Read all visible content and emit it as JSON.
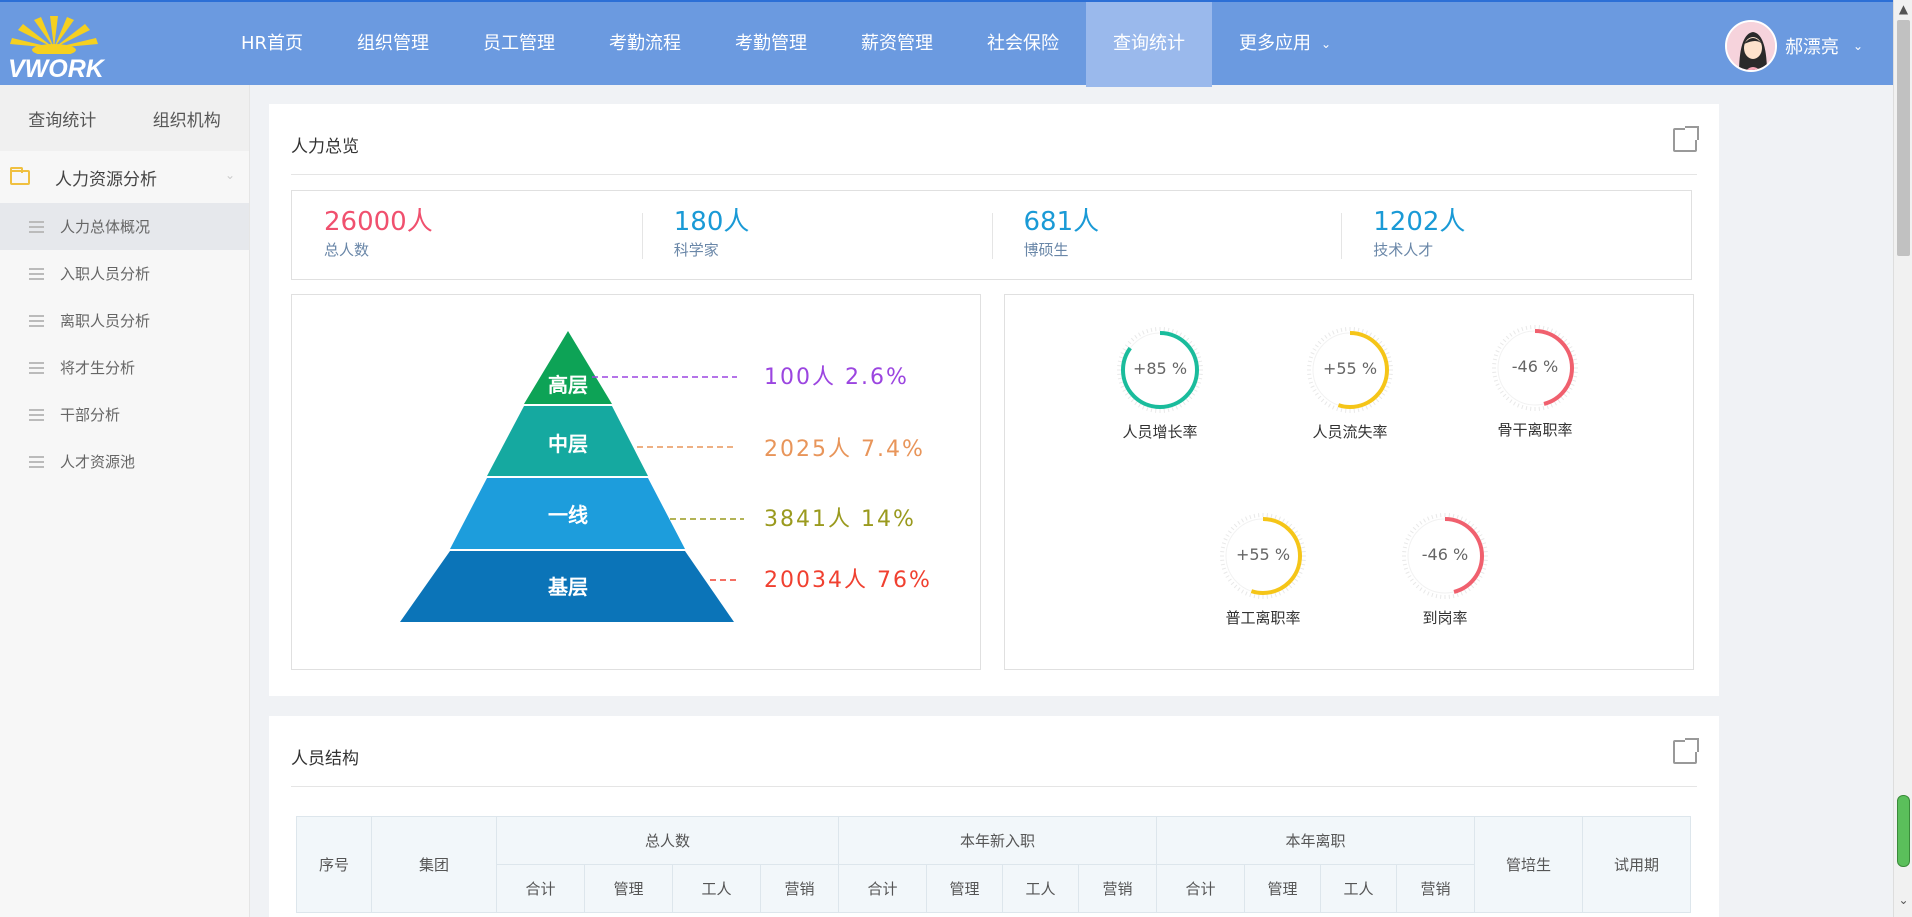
{
  "logo": {
    "text": "VWORK"
  },
  "nav": {
    "items": [
      {
        "label": "HR首页"
      },
      {
        "label": "组织管理"
      },
      {
        "label": "员工管理"
      },
      {
        "label": "考勤流程"
      },
      {
        "label": "考勤管理"
      },
      {
        "label": "薪资管理"
      },
      {
        "label": "社会保险"
      },
      {
        "label": "查询统计",
        "active": true
      },
      {
        "label": "更多应用"
      }
    ]
  },
  "user": {
    "name": "郝漂亮"
  },
  "sidebar": {
    "tabs": [
      "查询统计",
      "组织机构"
    ],
    "group": "人力资源分析",
    "items": [
      "人力总体概况",
      "入职人员分析",
      "离职人员分析",
      "将才生分析",
      "干部分析",
      "人才资源池"
    ],
    "active_index": 0
  },
  "overview": {
    "title": "人力总览",
    "stats": [
      {
        "value": "26000人",
        "label": "总人数",
        "color": "#f0506e"
      },
      {
        "value": "180人",
        "label": "科学家",
        "color": "#1a9ad6"
      },
      {
        "value": "681人",
        "label": "博硕生",
        "color": "#1a9ad6"
      },
      {
        "value": "1202人",
        "label": "技术人才",
        "color": "#1a9ad6"
      }
    ],
    "pyramid": [
      {
        "level": "高层",
        "text": "100人 2.6%",
        "color": "#0da356",
        "label_color": "#9b45e0"
      },
      {
        "level": "中层",
        "text": "2025人 7.4%",
        "color": "#15a9a0",
        "label_color": "#e8955a"
      },
      {
        "level": "一线",
        "text": "3841人 14%",
        "color": "#1d9ddc",
        "label_color": "#9a9a1e"
      },
      {
        "level": "基层",
        "text": "20034人 76%",
        "color": "#0b74b8",
        "label_color": "#f04030"
      }
    ],
    "gauges": [
      {
        "value": "+85 %",
        "label": "人员增长率",
        "percent": 85,
        "color": "#1abc9c"
      },
      {
        "value": "+55 %",
        "label": "人员流失率",
        "percent": 55,
        "color": "#f5c518"
      },
      {
        "value": "-46 %",
        "label": "骨干离职率",
        "percent": 46,
        "color": "#f0606e"
      },
      {
        "value": "+55 %",
        "label": "普工离职率",
        "percent": 55,
        "color": "#f5c518"
      },
      {
        "value": "-46 %",
        "label": "到岗率",
        "percent": 46,
        "color": "#f0606e"
      }
    ]
  },
  "structure": {
    "title": "人员结构",
    "headers": {
      "seq": "序号",
      "group": "集团",
      "total": "总人数",
      "new_hires": "本年新入职",
      "leavers": "本年离职",
      "trainee": "管培生",
      "probation": "试用期"
    },
    "sub_headers": [
      "合计",
      "管理",
      "工人",
      "营销"
    ]
  }
}
